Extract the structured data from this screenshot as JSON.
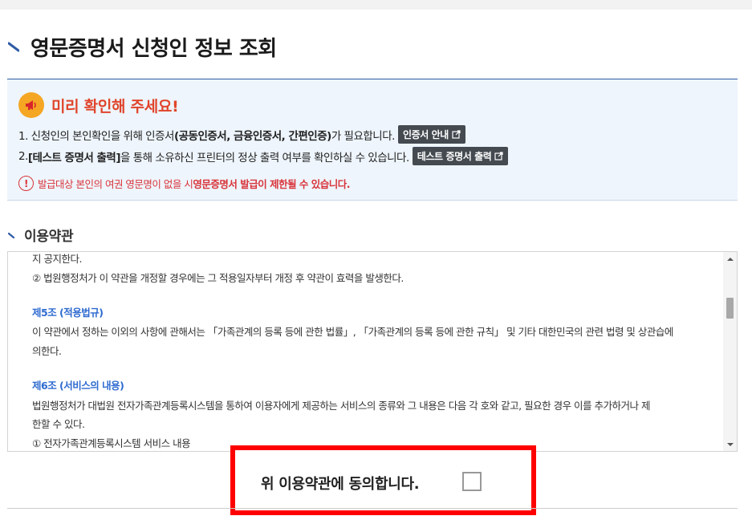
{
  "header": {
    "title": "영문증명서 신청인 정보 조회"
  },
  "notice": {
    "title": "미리 확인해 주세요!",
    "line1_a": "1. 신청인의 본인확인을 위해 인증서",
    "line1_b": "(공동인증서, 금융인증서, 간편인증)",
    "line1_c": "가 필요합니다.",
    "line1_button": "인증서 안내",
    "line2_a": "2. ",
    "line2_b": "[테스트 증명서 출력]",
    "line2_c": "을 통해 소유하신 프린터의 정상 출력 여부를 확인하실 수 있습니다.",
    "line2_button": "테스트 증명서 출력",
    "warning_mark": "!",
    "warning_a": "발급대상 본인의 여권 영문명이 없을 시 ",
    "warning_b": "영문증명서 발급이 제한될 수 있습니다."
  },
  "terms": {
    "title": "이용약관",
    "lines": [
      "지 공지한다.",
      "② 법원행정처가 이 약관을 개정할 경우에는 그 적용일자부터 개정 후 약관이 효력을 발생한다.",
      "제5조 (적용법규)",
      "이 약관에서 정하는 이외의 사항에 관해서는 「가족관계의 등록 등에 관한 법률」, 「가족관계의 등록 등에 관한 규칙」 및 기타 대한민국의 관련 법령 및 상관습에",
      "의한다.",
      "제6조 (서비스의 내용)",
      "법원행정처가 대법원 전자가족관계등록시스템을 통하여 이용자에게 제공하는 서비스의 종류와 그 내용은 다음 각 호와 같고, 필요한 경우 이를 추가하거나 제",
      "한할 수 있다.",
      "① 전자가족관계등록시스템 서비스 내용"
    ]
  },
  "agree": {
    "label": "위 이용약관에 동의합니다."
  },
  "colors": {
    "accent": "#2f5ba6",
    "notice_title": "#e0452b",
    "warning": "#d9343a",
    "article_heading": "#2f6bd0",
    "highlight_box": "#ff0000"
  },
  "icons": {
    "title_mark": "diagonal-stroke-icon",
    "notice": "megaphone-icon",
    "external": "external-link-icon",
    "warning": "exclamation-circle-icon",
    "scroll_up": "arrow-up-icon",
    "scroll_down": "arrow-down-icon"
  }
}
